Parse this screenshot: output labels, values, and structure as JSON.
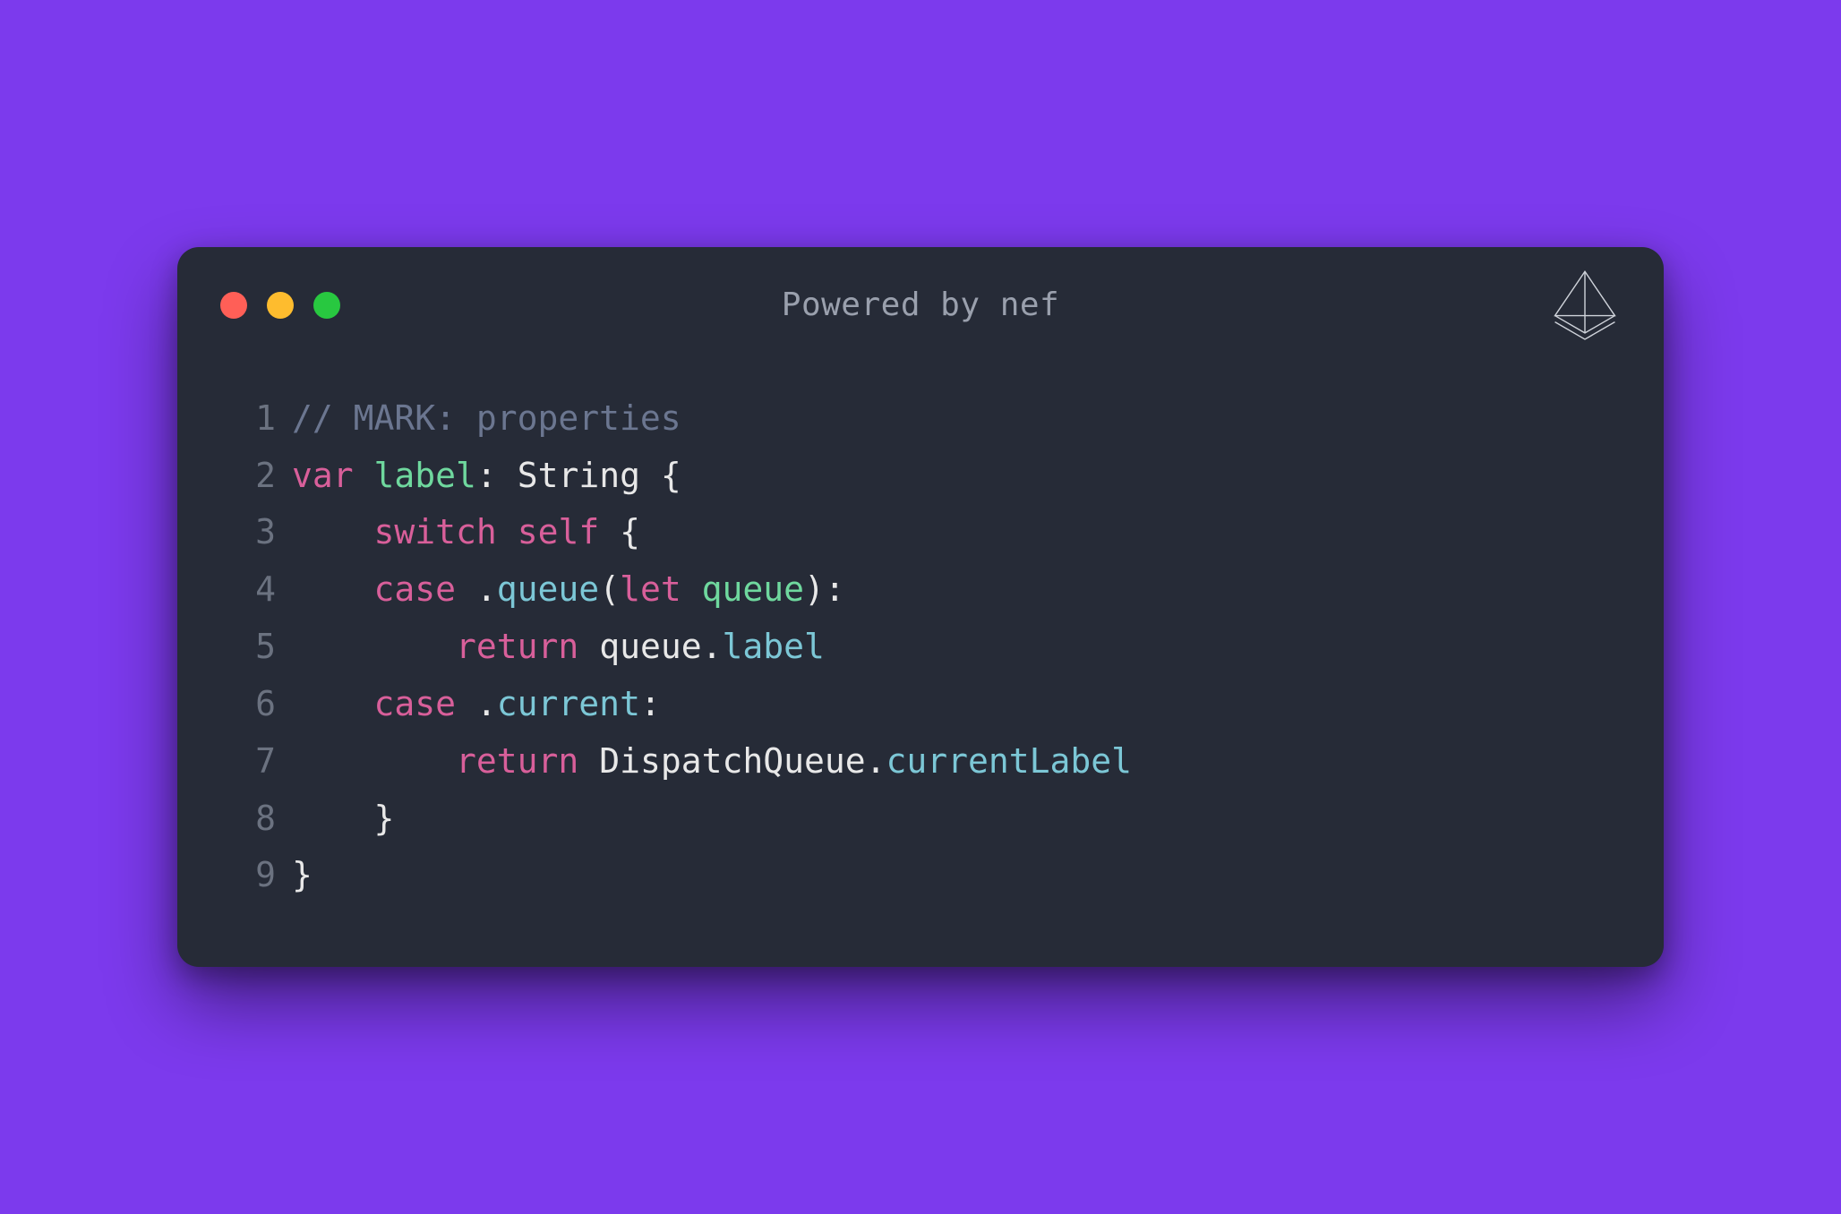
{
  "window": {
    "title": "Powered by nef",
    "traffic_lights": {
      "red": "#ff5f57",
      "yellow": "#febc2e",
      "green": "#28c840"
    },
    "logo": "nef-logo"
  },
  "colors": {
    "background": "#7c3aed",
    "window_bg": "#262b37",
    "comment": "#6b7690",
    "keyword": "#d85f9a",
    "identifier": "#6fd89e",
    "type": "#e8e8e8",
    "plain": "#e8e8e8",
    "member": "#7cc7d6",
    "line_number": "#6b7280"
  },
  "code": {
    "lines": [
      {
        "n": "1",
        "tokens": [
          {
            "t": "// MARK: properties",
            "c": "comment"
          }
        ]
      },
      {
        "n": "2",
        "tokens": [
          {
            "t": "var",
            "c": "keyword"
          },
          {
            "t": " ",
            "c": "plain"
          },
          {
            "t": "label",
            "c": "ident"
          },
          {
            "t": ": ",
            "c": "plain"
          },
          {
            "t": "String",
            "c": "type"
          },
          {
            "t": " {",
            "c": "plain"
          }
        ]
      },
      {
        "n": "3",
        "tokens": [
          {
            "t": "    ",
            "c": "plain"
          },
          {
            "t": "switch",
            "c": "keyword"
          },
          {
            "t": " ",
            "c": "plain"
          },
          {
            "t": "self",
            "c": "keyword"
          },
          {
            "t": " {",
            "c": "plain"
          }
        ]
      },
      {
        "n": "4",
        "tokens": [
          {
            "t": "    ",
            "c": "plain"
          },
          {
            "t": "case",
            "c": "keyword"
          },
          {
            "t": " .",
            "c": "plain"
          },
          {
            "t": "queue",
            "c": "member"
          },
          {
            "t": "(",
            "c": "plain"
          },
          {
            "t": "let",
            "c": "keyword"
          },
          {
            "t": " ",
            "c": "plain"
          },
          {
            "t": "queue",
            "c": "ident"
          },
          {
            "t": "):",
            "c": "plain"
          }
        ]
      },
      {
        "n": "5",
        "tokens": [
          {
            "t": "        ",
            "c": "plain"
          },
          {
            "t": "return",
            "c": "keyword"
          },
          {
            "t": " queue.",
            "c": "plain"
          },
          {
            "t": "label",
            "c": "member"
          }
        ]
      },
      {
        "n": "6",
        "tokens": [
          {
            "t": "    ",
            "c": "plain"
          },
          {
            "t": "case",
            "c": "keyword"
          },
          {
            "t": " .",
            "c": "plain"
          },
          {
            "t": "current",
            "c": "member"
          },
          {
            "t": ":",
            "c": "plain"
          }
        ]
      },
      {
        "n": "7",
        "tokens": [
          {
            "t": "        ",
            "c": "plain"
          },
          {
            "t": "return",
            "c": "keyword"
          },
          {
            "t": " DispatchQueue.",
            "c": "plain"
          },
          {
            "t": "currentLabel",
            "c": "member"
          }
        ]
      },
      {
        "n": "8",
        "tokens": [
          {
            "t": "    }",
            "c": "plain"
          }
        ]
      },
      {
        "n": "9",
        "tokens": [
          {
            "t": "}",
            "c": "plain"
          }
        ]
      }
    ]
  }
}
